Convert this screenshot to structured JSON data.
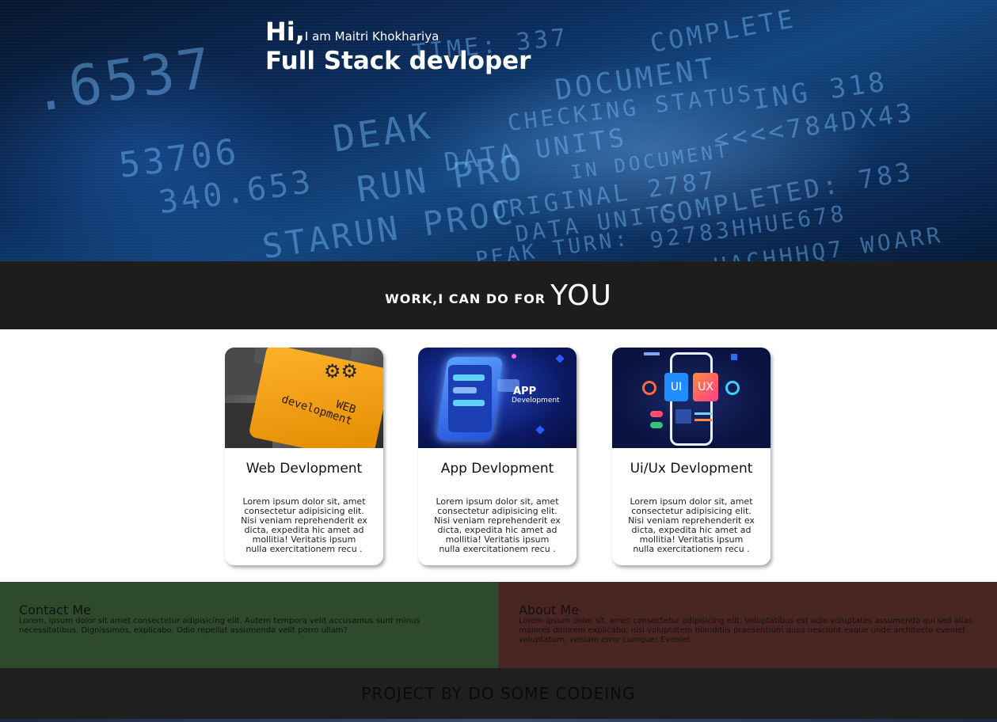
{
  "hero": {
    "greeting": "Hi,",
    "intro": "I am Maitri Khokhariya",
    "role": "Full Stack devloper"
  },
  "services": {
    "heading_small": "WORK,I CAN DO FOR",
    "heading_big": "YOU",
    "cards": [
      {
        "title": "Web Devlopment",
        "image_label": "WEB development",
        "text": "Lorem ipsum dolor sit, amet consectetur adipisicing elit. Nisi veniam reprehenderit ex dicta, expedita hic amet ad mollitia! Veritatis ipsum nulla exercitationem recu ."
      },
      {
        "title": "App Devlopment",
        "image_label_1": "APP",
        "image_label_2": "Development",
        "text": "Lorem ipsum dolor sit, amet consectetur adipisicing elit. Nisi veniam reprehenderit ex dicta, expedita hic amet ad mollitia! Veritatis ipsum nulla exercitationem recu ."
      },
      {
        "title": "Ui/Ux Devlopment",
        "image_label_1": "UI",
        "image_label_2": "UX",
        "text": "Lorem ipsum dolor sit, amet consectetur adipisicing elit. Nisi veniam reprehenderit ex dicta, expedita hic amet ad mollitia! Veritatis ipsum nulla exercitationem recu ."
      }
    ]
  },
  "contact": {
    "title": "Contact Me",
    "text": "Lorem, ipsum dolor sit amet consectetur adipisicing elit. Autem tempora velit accusamus sunt minus necessitatibus. Dignissimos, explicabo. Odio repellat assumenda velit porro ullam?"
  },
  "about": {
    "title": "About Me",
    "text": "Lorem ipsum dolor sit, amet consectetur adipisicing elit. Voluptatibus est odio voluptates assumenda qui sed alias maiores dolorem explicabo, nisi voluptatem blanditiis praesentium quos nesciunt eaque unde architecto eveniet voluptatum, veniam error cumque! Eveniet."
  },
  "footer": {
    "text": "PROJECT BY DO SOME CODEING"
  },
  "colors": {
    "contact_bg": "#2e4a2d",
    "about_bg": "#4a2623",
    "dark_band": "#1f1c1c",
    "ui_gradient": "#3aa0ff",
    "ux_gradient": "#ff7a3a"
  }
}
